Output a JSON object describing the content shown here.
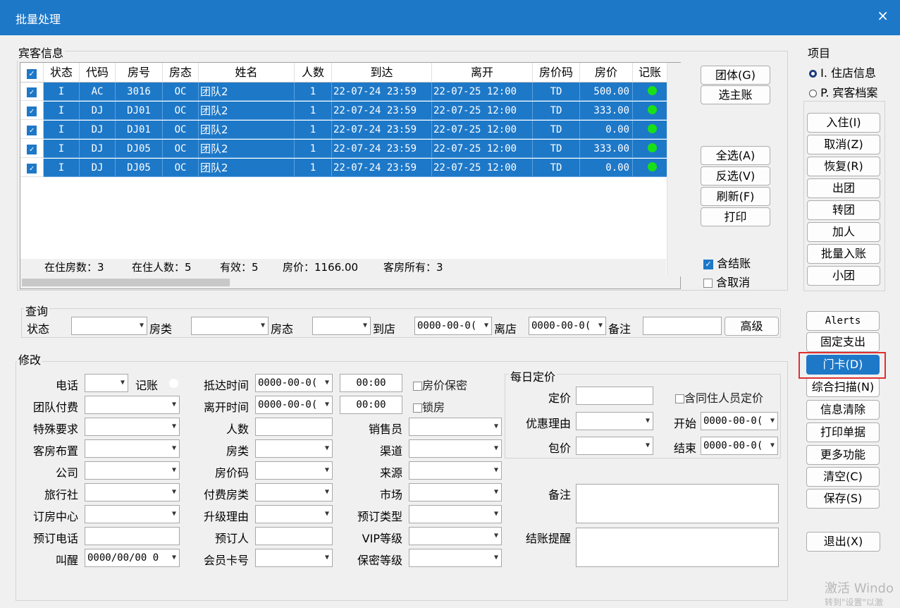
{
  "window": {
    "title": "批量处理",
    "close": "×"
  },
  "guest": {
    "group_label": "宾客信息",
    "columns": [
      "状态",
      "代码",
      "房号",
      "房态",
      "姓名",
      "人数",
      "到达",
      "离开",
      "房价码",
      "房价",
      "记账"
    ],
    "rows": [
      {
        "status": "I",
        "code": "AC",
        "room": "3016",
        "rstate": "OC",
        "name": "团队2",
        "count": "1",
        "arrive": "22-07-24 23:59",
        "depart": "22-07-25 12:00",
        "ratecode": "TD",
        "rate": "500.00"
      },
      {
        "status": "I",
        "code": "DJ",
        "room": "DJ01",
        "rstate": "OC",
        "name": "团队2",
        "count": "1",
        "arrive": "22-07-24 23:59",
        "depart": "22-07-25 12:00",
        "ratecode": "TD",
        "rate": "333.00"
      },
      {
        "status": "I",
        "code": "DJ",
        "room": "DJ01",
        "rstate": "OC",
        "name": "团队2",
        "count": "1",
        "arrive": "22-07-24 23:59",
        "depart": "22-07-25 12:00",
        "ratecode": "TD",
        "rate": "0.00"
      },
      {
        "status": "I",
        "code": "DJ",
        "room": "DJ05",
        "rstate": "OC",
        "name": "团队2",
        "count": "1",
        "arrive": "22-07-24 23:59",
        "depart": "22-07-25 12:00",
        "ratecode": "TD",
        "rate": "333.00"
      },
      {
        "status": "I",
        "code": "DJ",
        "room": "DJ05",
        "rstate": "OC",
        "name": "团队2",
        "count": "1",
        "arrive": "22-07-24 23:59",
        "depart": "22-07-25 12:00",
        "ratecode": "TD",
        "rate": "0.00"
      }
    ],
    "summary": {
      "rooms": "在住房数：3",
      "persons": "在住人数：5",
      "valid": "有效：5",
      "price": "房价：1166.00",
      "owner": "客房所有：3"
    },
    "side_buttons": {
      "group": "团体(G)",
      "main": "选主账",
      "select_all": "全选(A)",
      "invert": "反选(V)",
      "refresh": "刷新(F)",
      "print": "打印"
    },
    "include_checkout": "含结账",
    "include_cancel": "含取消"
  },
  "project": {
    "label": "项目",
    "opt1": "I. 住店信息",
    "opt2": "P. 宾客档案"
  },
  "right_buttons": [
    "入住(I)",
    "取消(Z)",
    "恢复(R)",
    "出团",
    "转团",
    "加人",
    "批量入账",
    "小团"
  ],
  "right_buttons2": [
    "Alerts",
    "固定支出",
    "门卡(D)",
    "综合扫描(N)",
    "信息清除",
    "打印单据",
    "更多功能",
    "清空(C)",
    "保存(S)"
  ],
  "exit_button": "退出(X)",
  "query": {
    "label": "查询",
    "status": "状态",
    "room_type": "房类",
    "room_state": "房态",
    "arrive": "到店",
    "arrive_val": "0000-00-0(",
    "depart": "离店",
    "depart_val": "0000-00-0(",
    "note": "备注",
    "advanced": "高级"
  },
  "modify": {
    "label": "修改",
    "phone": "电话",
    "account": "记账",
    "arrive_time": "抵达时间",
    "date_val": "0000-00-0(",
    "time_val": "00:00",
    "rate_secret": "房价保密",
    "team_pay": "团队付费",
    "depart_time": "离开时间",
    "lock_room": "锁房",
    "special": "特殊要求",
    "persons": "人数",
    "sales": "销售员",
    "layout": "客房布置",
    "room_type": "房类",
    "channel": "渠道",
    "company": "公司",
    "rate_code": "房价码",
    "source": "来源",
    "agency": "旅行社",
    "pay_room_type": "付费房类",
    "market": "市场",
    "center": "订房中心",
    "upgrade": "升级理由",
    "book_type": "预订类型",
    "book_phone": "预订电话",
    "booker": "预订人",
    "vip": "VIP等级",
    "wake": "叫醒",
    "wake_val": "0000/00/00 0",
    "member_card": "会员卡号",
    "secret_level": "保密等级",
    "daily_label": "每日定价",
    "set_price": "定价",
    "with_roommates": "含同住人员定价",
    "discount": "优惠理由",
    "start": "开始",
    "package": "包价",
    "end": "结束",
    "note": "备注",
    "checkout_remind": "结账提醒"
  },
  "watermark": {
    "line1": "激活 Windo",
    "line2": "转到\"设置\"以激"
  },
  "colors": {
    "accent": "#1e78c8",
    "highlight_border": "#e03030",
    "dot": "#18e018"
  }
}
